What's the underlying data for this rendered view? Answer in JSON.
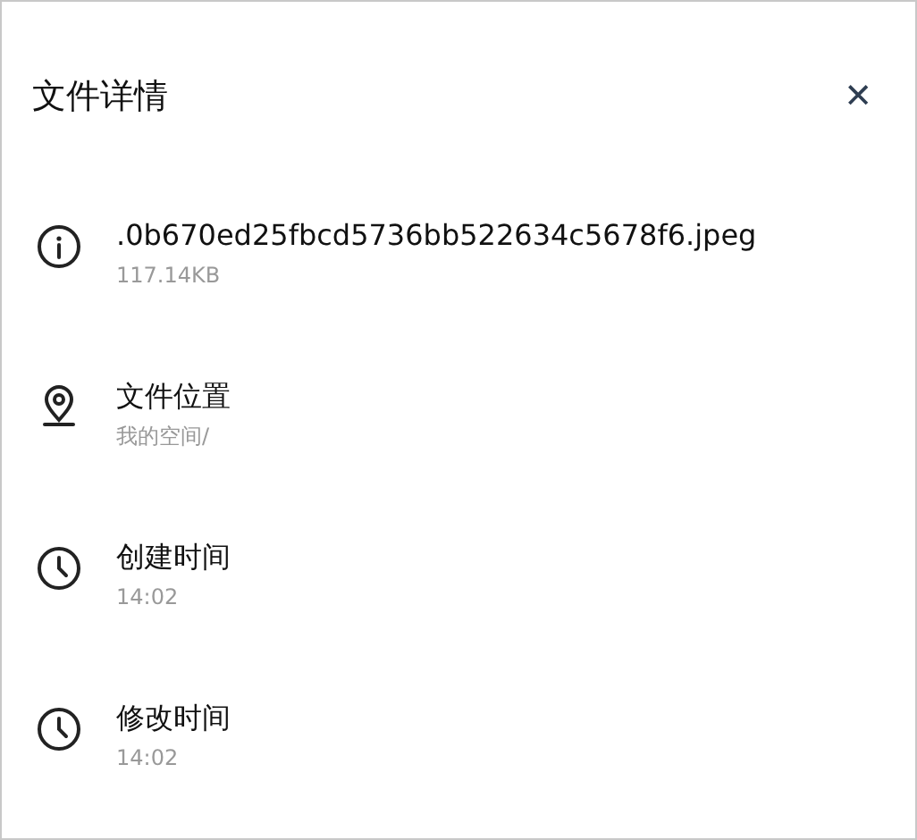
{
  "header": {
    "title": "文件详情",
    "close": "✕"
  },
  "items": [
    {
      "kind": "info",
      "title": ".0b670ed25fbcd5736bb522634c5678f6.jpeg",
      "subtitle": "117.14KB"
    },
    {
      "kind": "location",
      "title": "文件位置",
      "subtitle": "我的空间/"
    },
    {
      "kind": "clock",
      "title": "创建时间",
      "subtitle": "14:02"
    },
    {
      "kind": "clock",
      "title": "修改时间",
      "subtitle": "14:02"
    }
  ]
}
